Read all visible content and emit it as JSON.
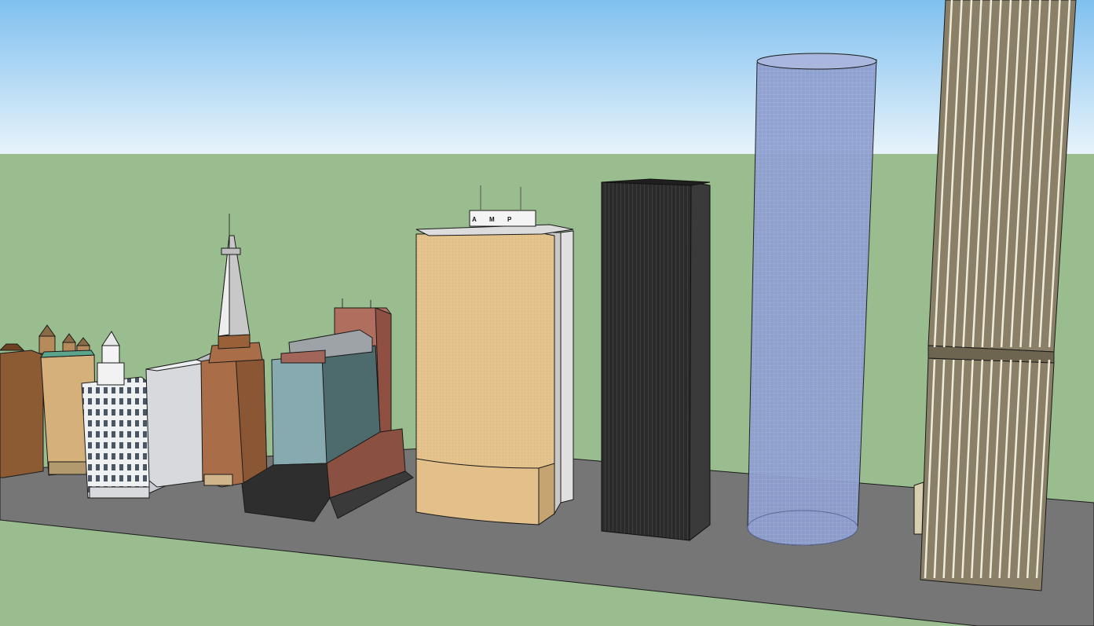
{
  "scene": {
    "description_free": true,
    "colors": {
      "sky_top": "#7fc0ee",
      "sky_bottom": "#e7f3fb",
      "ground": "#99bd8f",
      "road": "#767676",
      "edge": "#1a1a1a"
    }
  },
  "buildings": {
    "amp_tower": {
      "sign_letters": [
        "A",
        "M",
        "P"
      ],
      "colors": {
        "face": "#e6c48e",
        "side": "#c9c9c9"
      }
    },
    "black_tower": {
      "colors": {
        "face": "#2b2b2b",
        "side": "#3a3a3a"
      }
    },
    "cylinder_tower": {
      "colors": {
        "body": "#8e9fcf",
        "top": "#a9b6de"
      }
    },
    "striped_tower": {
      "colors": {
        "stripe": "#8a8068",
        "gap": "#e8e4d6"
      }
    },
    "glass_tower": {
      "colors": {
        "glass": "#86aab0",
        "brick": "#b06e5e"
      }
    },
    "spire_tower": {
      "colors": {
        "brick": "#a96e47",
        "spire": "#c8c8c8"
      }
    },
    "white_tower": {
      "colors": {
        "face": "#eef0f2",
        "window": "#4a5664"
      }
    },
    "heritage_row": {
      "colors": {
        "brown": "#8c5a33",
        "sand": "#d6b07a"
      }
    }
  }
}
